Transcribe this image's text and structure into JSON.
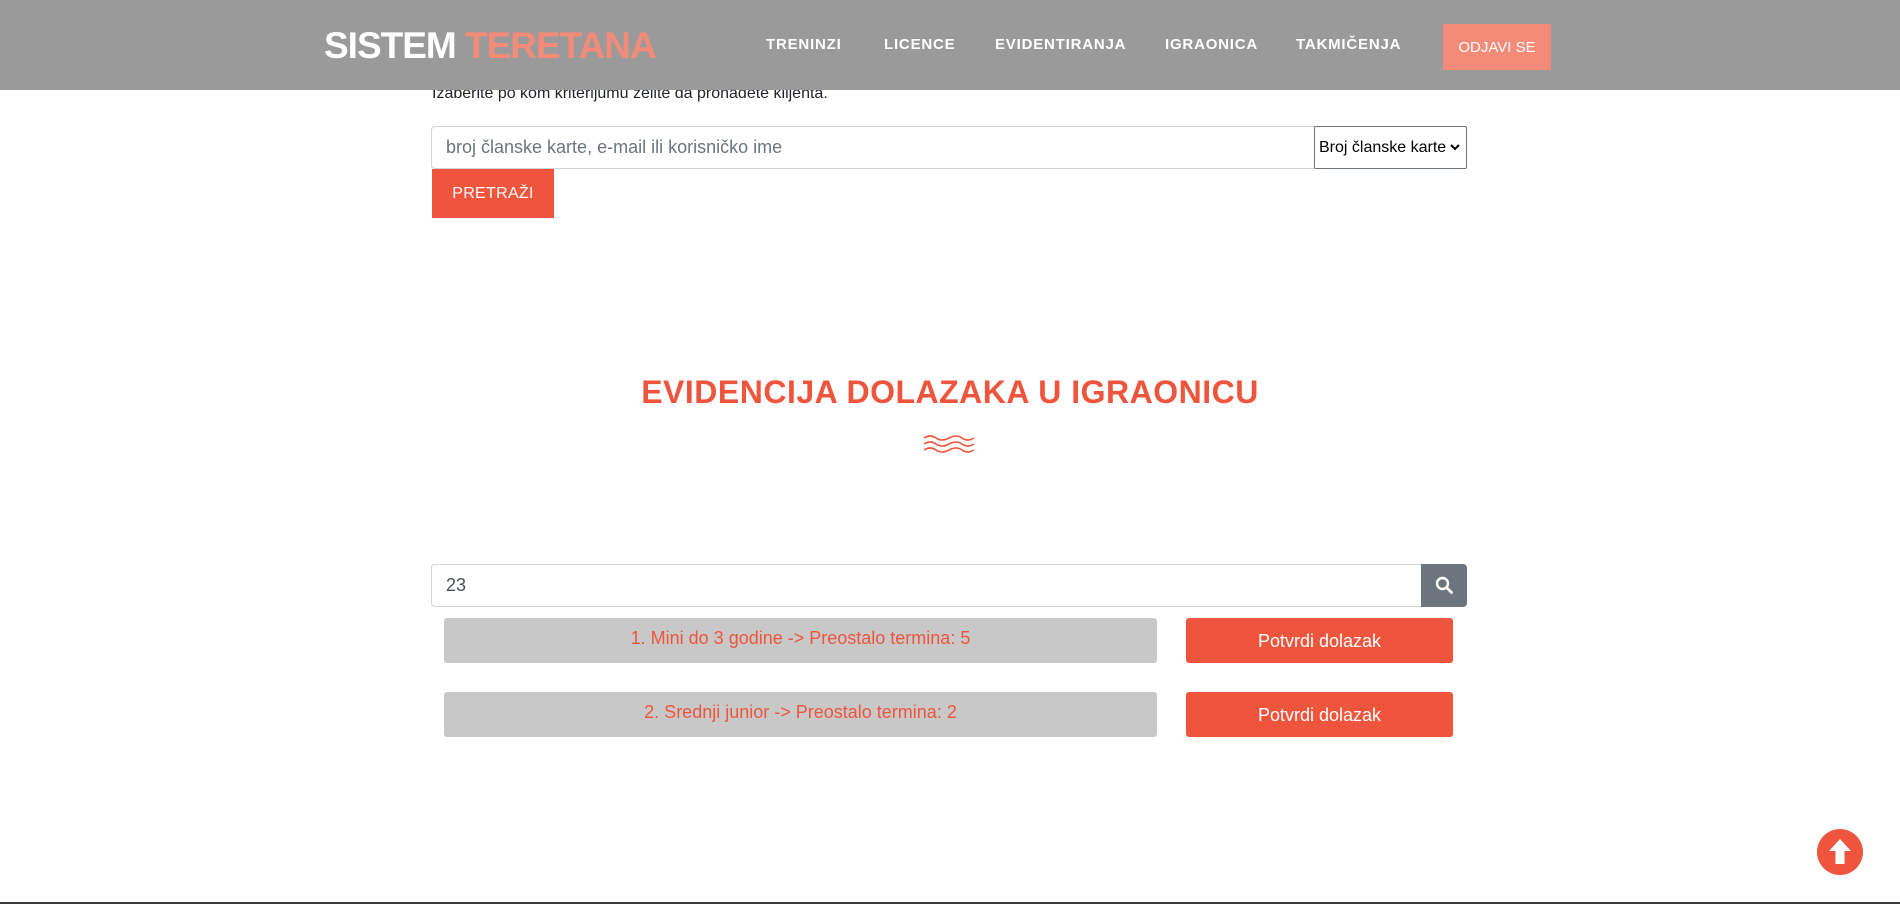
{
  "header": {
    "brand_part1": "SISTEM",
    "brand_part2": "TERETANA",
    "nav": [
      "TRENINZI",
      "LICENCE",
      "EVIDENTIRANJA",
      "IGRAONICA",
      "TAKMIČENJA"
    ],
    "logout_label": "ODJAVI SE"
  },
  "client_search": {
    "instruction": "Izaberite po kom kriterijumu želite da pronađete klijenta.",
    "placeholder": "broj članske karte, e-mail ili korisničko ime",
    "criteria_selected": "Broj članske karte",
    "search_label": "PRETRAŽI"
  },
  "attendance": {
    "title": "EVIDENCIJA DOLAZAKA U IGRAONICU",
    "member_value": "23",
    "packages": [
      {
        "label": "1. Mini do 3 godine -> Preostalo termina: 5",
        "button": "Potvrdi dolazak"
      },
      {
        "label": "2. Srednji junior -> Preostalo termina: 2",
        "button": "Potvrdi dolazak"
      }
    ]
  },
  "colors": {
    "accent": "#ee553c",
    "accent_light": "#f48b79",
    "header_bg": "#9a9a9a",
    "row_bg": "#c8c8c8"
  },
  "icons": {
    "search": "search-icon",
    "scroll_top": "arrow-circle-up-icon",
    "divider": "waves-icon"
  }
}
